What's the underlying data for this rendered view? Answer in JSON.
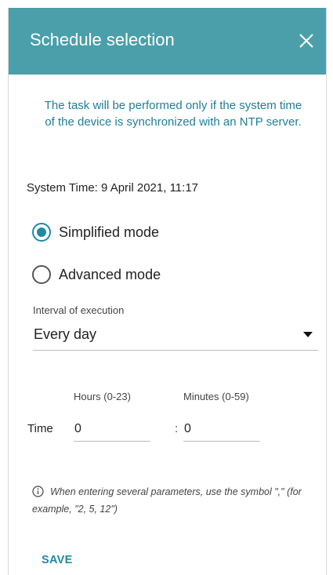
{
  "dialog": {
    "title": "Schedule selection",
    "close_icon": "close-icon",
    "accent_color": "#4a9fab"
  },
  "notice": "The task will be performed only if the system time of the device is synchronized with an NTP server.",
  "system_time": "System Time: 9 April 2021, 11:17",
  "modes": {
    "simplified": {
      "label": "Simplified mode",
      "checked": true
    },
    "advanced": {
      "label": "Advanced mode",
      "checked": false
    }
  },
  "interval": {
    "label": "Interval of execution",
    "value": "Every day"
  },
  "time": {
    "label": "Time",
    "separator": ":",
    "hours": {
      "label": "Hours (0-23)",
      "value": "0"
    },
    "minutes": {
      "label": "Minutes (0-59)",
      "value": "0"
    }
  },
  "info": {
    "icon": "info-icon",
    "text": "When entering several parameters, use the symbol \",\" (for example, \"2, 5, 12\")"
  },
  "actions": {
    "save_label": "SAVE"
  }
}
